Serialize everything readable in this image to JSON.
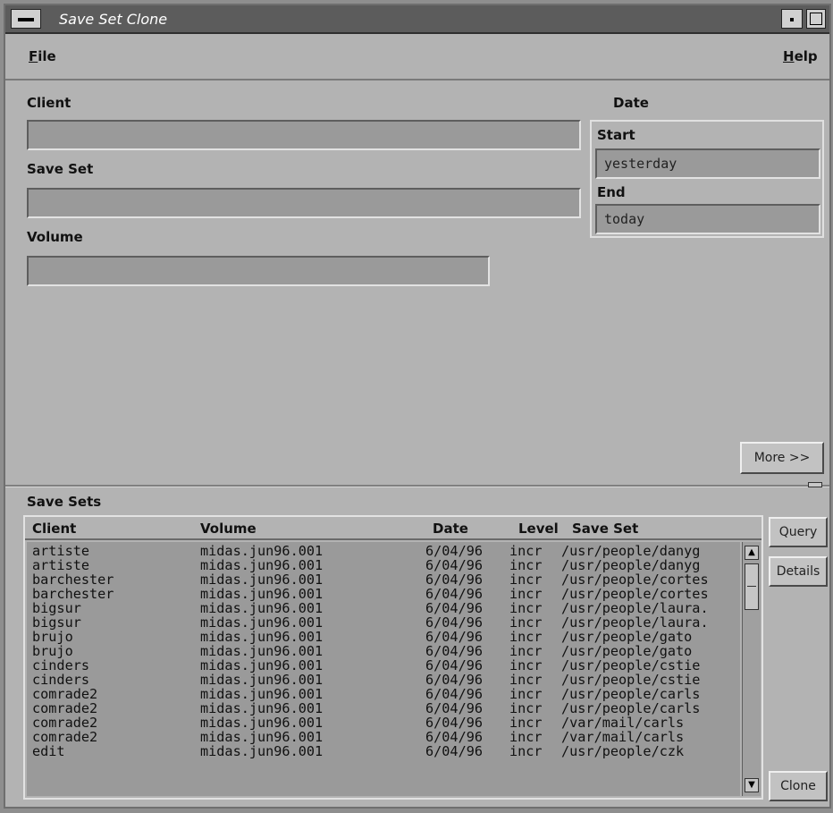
{
  "window": {
    "title": "Save Set Clone"
  },
  "menubar": {
    "file_label": "ile",
    "file_mnemonic": "F",
    "help_label": "elp",
    "help_mnemonic": "H"
  },
  "form": {
    "client_label": "Client",
    "client_value": "",
    "saveset_label": "Save Set",
    "saveset_value": "",
    "volume_label": "Volume",
    "volume_value": "",
    "date_label": "Date",
    "start_label": "Start",
    "start_value": "yesterday",
    "end_label": "End",
    "end_value": "today",
    "more_button": "More >>"
  },
  "savesets": {
    "title": "Save Sets",
    "columns": [
      "Client",
      "Volume",
      "Date",
      "Level",
      "Save Set"
    ],
    "rows": [
      [
        "artiste",
        "midas.jun96.001",
        "6/04/96",
        "incr",
        "/usr/people/danyg"
      ],
      [
        "artiste",
        "midas.jun96.001",
        "6/04/96",
        "incr",
        "/usr/people/danyg"
      ],
      [
        "barchester",
        "midas.jun96.001",
        "6/04/96",
        "incr",
        "/usr/people/cortes"
      ],
      [
        "barchester",
        "midas.jun96.001",
        "6/04/96",
        "incr",
        "/usr/people/cortes"
      ],
      [
        "bigsur",
        "midas.jun96.001",
        "6/04/96",
        "incr",
        "/usr/people/laura."
      ],
      [
        "bigsur",
        "midas.jun96.001",
        "6/04/96",
        "incr",
        "/usr/people/laura."
      ],
      [
        "brujo",
        "midas.jun96.001",
        "6/04/96",
        "incr",
        "/usr/people/gato"
      ],
      [
        "brujo",
        "midas.jun96.001",
        "6/04/96",
        "incr",
        "/usr/people/gato"
      ],
      [
        "cinders",
        "midas.jun96.001",
        "6/04/96",
        "incr",
        "/usr/people/cstie"
      ],
      [
        "cinders",
        "midas.jun96.001",
        "6/04/96",
        "incr",
        "/usr/people/cstie"
      ],
      [
        "comrade2",
        "midas.jun96.001",
        "6/04/96",
        "incr",
        "/usr/people/carls"
      ],
      [
        "comrade2",
        "midas.jun96.001",
        "6/04/96",
        "incr",
        "/usr/people/carls"
      ],
      [
        "comrade2",
        "midas.jun96.001",
        "6/04/96",
        "incr",
        "/var/mail/carls"
      ],
      [
        "comrade2",
        "midas.jun96.001",
        "6/04/96",
        "incr",
        "/var/mail/carls"
      ],
      [
        "edit",
        "midas.jun96.001",
        "6/04/96",
        "incr",
        "/usr/people/czk"
      ]
    ],
    "query_button": "Query",
    "details_button": "Details",
    "clone_button": "Clone"
  }
}
